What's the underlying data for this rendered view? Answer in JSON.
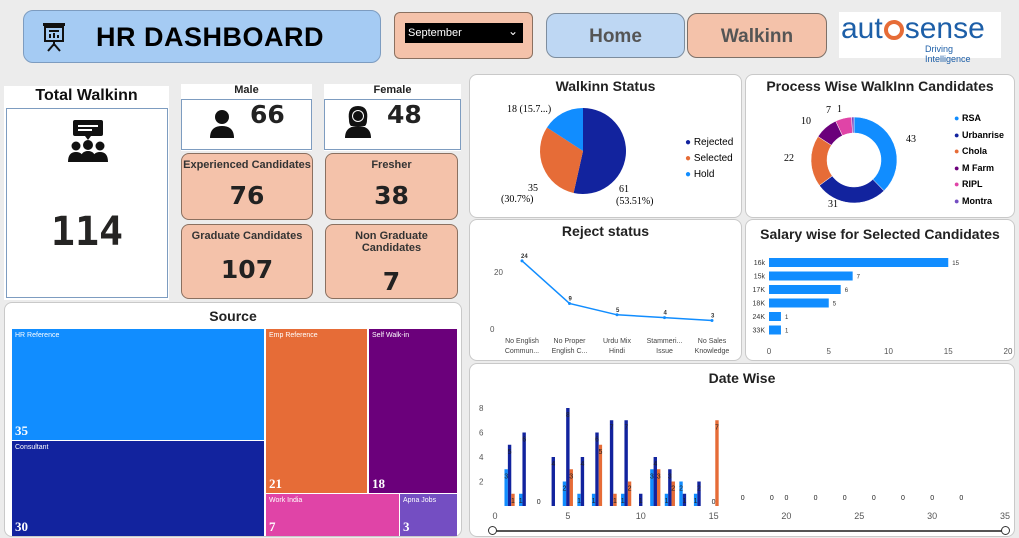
{
  "header": {
    "title": "HR DASHBOARD",
    "month_select": "September",
    "nav_home": "Home",
    "nav_walkin": "Walkinn",
    "logo_brand_left": "aut",
    "logo_brand_right": "sense",
    "logo_tagline": "Driving Intelligence"
  },
  "kpi": {
    "total_title": "Total Walkinn",
    "total_value": "114",
    "male_label": "Male",
    "male_value": "66",
    "female_label": "Female",
    "female_value": "48",
    "experienced_label": "Experienced Candidates",
    "experienced_value": "76",
    "fresher_label": "Fresher",
    "fresher_value": "38",
    "graduate_label": "Graduate Candidates",
    "graduate_value": "107",
    "nongraduate_label": "Non Graduate Candidates",
    "nongraduate_value": "7"
  },
  "source": {
    "title": "Source",
    "items": [
      {
        "label": "HR Reference",
        "value": "35",
        "color": "#118dff"
      },
      {
        "label": "Consultant",
        "value": "30",
        "color": "#12239e"
      },
      {
        "label": "Emp Reference",
        "value": "21",
        "color": "#e66c37"
      },
      {
        "label": "Self Walk-in",
        "value": "18",
        "color": "#6b007b"
      },
      {
        "label": "Work India",
        "value": "7",
        "color": "#e044a7"
      },
      {
        "label": "Apna Jobs",
        "value": "3",
        "color": "#744ec2"
      }
    ]
  },
  "walkin_status": {
    "title": "Walkinn Status",
    "legend": [
      "Rejected",
      "Selected",
      "Hold"
    ],
    "label_rejected_value": "61",
    "label_rejected_pct": "(53.51%)",
    "label_selected_value": "35",
    "label_selected_pct": "(30.7%)",
    "label_hold": "18 (15.7...)"
  },
  "process": {
    "title": "Process Wise WalkInn Candidates",
    "legend": [
      "RSA",
      "Urbanrise",
      "Chola",
      "M Farm",
      "RIPL",
      "Montra"
    ],
    "labels": [
      "43",
      "31",
      "22",
      "10",
      "7",
      "1"
    ]
  },
  "reject": {
    "title": "Reject status",
    "y_ticks": [
      "20",
      "0"
    ],
    "x_labels": [
      [
        "No English",
        "Commun..."
      ],
      [
        "No Proper",
        "English C..."
      ],
      [
        "Urdu Mix",
        "Hindi"
      ],
      [
        "Stammeri...",
        "Issue"
      ],
      [
        "No Sales",
        "Knowledge"
      ]
    ],
    "data_labels": [
      "24",
      "9",
      "5",
      "4",
      "3"
    ]
  },
  "salary": {
    "title": "Salary wise for Selected Candidates",
    "x_ticks": [
      "0",
      "5",
      "10",
      "15",
      "20"
    ]
  },
  "datewise": {
    "title": "Date Wise",
    "y_ticks": [
      "8",
      "6",
      "4",
      "2"
    ],
    "x_ticks": [
      "0",
      "5",
      "10",
      "15",
      "20",
      "25",
      "30",
      "35"
    ]
  },
  "chart_data": [
    {
      "type": "pie",
      "title": "Walkinn Status",
      "categories": [
        "Rejected",
        "Selected",
        "Hold"
      ],
      "values": [
        61,
        35,
        18
      ],
      "colors": [
        "#12239e",
        "#e66c37",
        "#118dff"
      ]
    },
    {
      "type": "pie",
      "title": "Process Wise WalkInn Candidates",
      "categories": [
        "RSA",
        "Urbanrise",
        "Chola",
        "M Farm",
        "RIPL",
        "Montra"
      ],
      "values": [
        43,
        31,
        22,
        10,
        7,
        1
      ],
      "colors": [
        "#118dff",
        "#12239e",
        "#e66c37",
        "#6b007b",
        "#e044a7",
        "#744ec2"
      ]
    },
    {
      "type": "line",
      "title": "Reject status",
      "categories": [
        "No English Commun...",
        "No Proper English C...",
        "Urdu Mix Hindi",
        "Stammeri... Issue",
        "No Sales Knowledge"
      ],
      "values": [
        24,
        9,
        5,
        4,
        3
      ],
      "ylim": [
        0,
        25
      ],
      "color": "#118dff"
    },
    {
      "type": "bar",
      "title": "Salary wise for Selected Candidates",
      "orientation": "horizontal",
      "categories": [
        "16k",
        "15k",
        "17K",
        "18K",
        "24K",
        "33K"
      ],
      "values": [
        15,
        7,
        6,
        5,
        1,
        1
      ],
      "xlim": [
        0,
        20
      ],
      "color": "#118dff"
    },
    {
      "type": "bar",
      "title": "Date Wise",
      "xlim": [
        0,
        35
      ],
      "ylim": [
        0,
        8
      ],
      "series_colors": [
        "#118dff",
        "#12239e",
        "#e66c37"
      ],
      "groups": [
        {
          "x": 1,
          "values": [
            3,
            5,
            1
          ]
        },
        {
          "x": 2,
          "values": [
            1,
            6,
            0
          ]
        },
        {
          "x": 3,
          "values": [
            0,
            0,
            0
          ]
        },
        {
          "x": 4,
          "values": [
            0,
            4,
            0
          ]
        },
        {
          "x": 5,
          "values": [
            2,
            8,
            3
          ]
        },
        {
          "x": 6,
          "values": [
            1,
            4,
            0
          ]
        },
        {
          "x": 7,
          "values": [
            1,
            6,
            5
          ]
        },
        {
          "x": 8,
          "values": [
            0,
            7,
            1
          ]
        },
        {
          "x": 9,
          "values": [
            1,
            7,
            2
          ]
        },
        {
          "x": 10,
          "values": [
            0,
            1,
            0
          ]
        },
        {
          "x": 11,
          "values": [
            3,
            4,
            3
          ]
        },
        {
          "x": 12,
          "values": [
            1,
            3,
            2
          ]
        },
        {
          "x": 13,
          "values": [
            2,
            1,
            0
          ]
        },
        {
          "x": 14,
          "values": [
            1,
            2,
            0
          ]
        },
        {
          "x": 15,
          "values": [
            0,
            0,
            7
          ]
        }
      ],
      "zeros_at": [
        17,
        19,
        20,
        22,
        24,
        26,
        28,
        30,
        32
      ]
    }
  ]
}
